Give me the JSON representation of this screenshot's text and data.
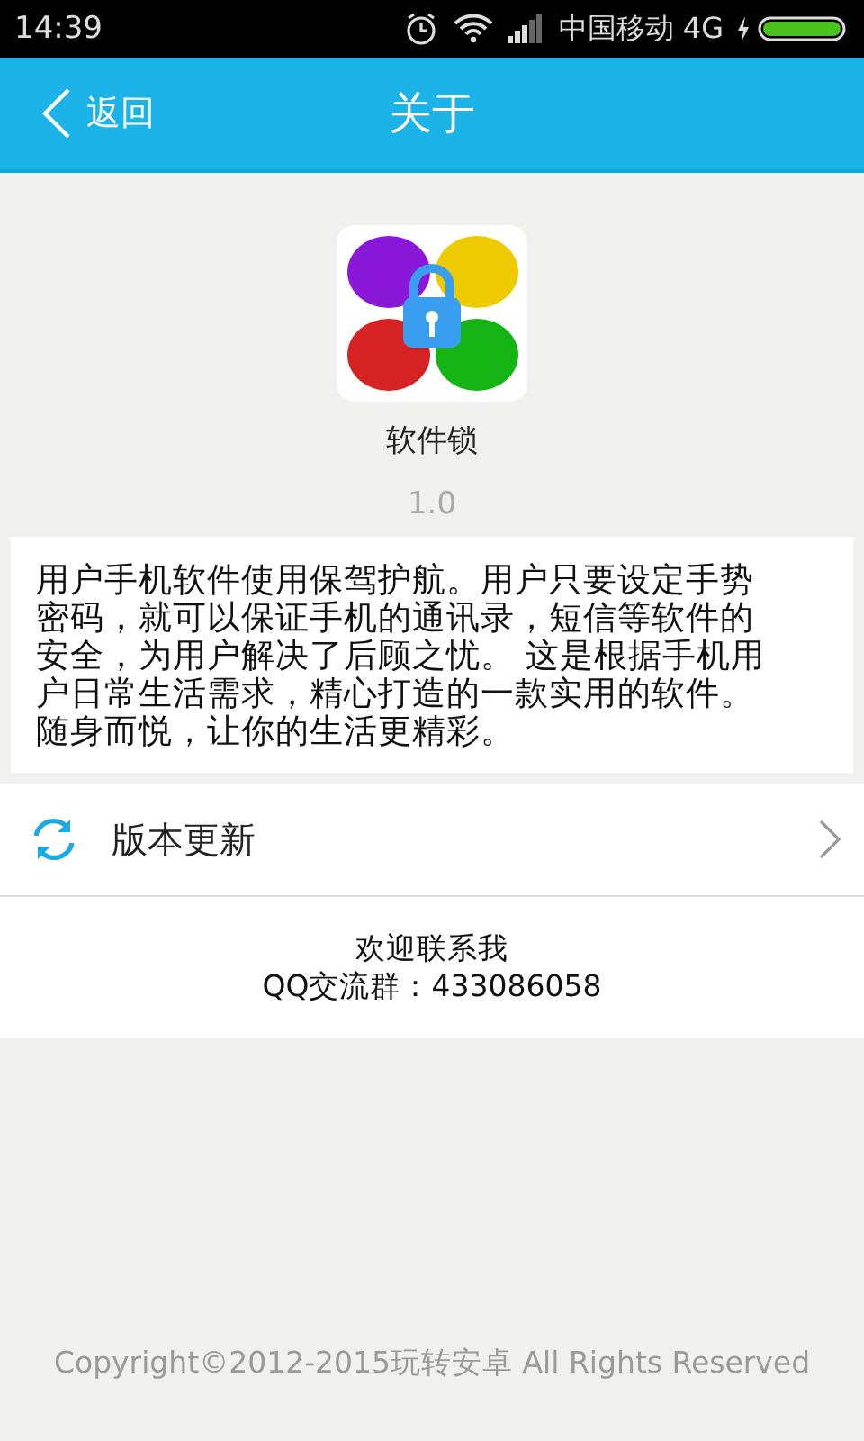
{
  "status_bar": {
    "time": "14:39",
    "carrier": "中国移动 4G"
  },
  "header": {
    "back": "返回",
    "title": "关于"
  },
  "app": {
    "name": "软件锁",
    "version": "1.0"
  },
  "description": "用户手机软件使用保驾护航。用户只要设定手势密码，就可以保证手机的通讯录，短信等软件的安全，为用户解决了后顾之忧。 这是根据手机用户日常生活需求，精心打造的一款实用的软件。随身而悦，让你的生活更精彩。",
  "update": {
    "label": "版本更新"
  },
  "contact": [
    "欢迎联系我",
    "QQ交流群：433086058"
  ],
  "footer": "Copyright©2012-2015玩转安卓 All Rights Reserved"
}
